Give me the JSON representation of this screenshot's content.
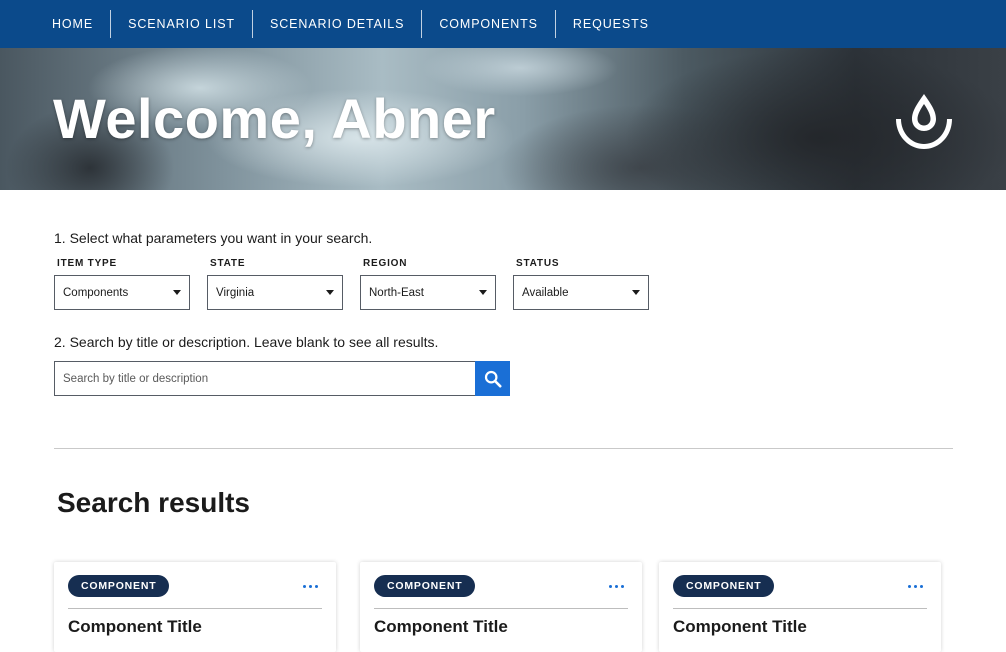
{
  "nav": {
    "items": [
      {
        "label": "HOME"
      },
      {
        "label": "SCENARIO LIST"
      },
      {
        "label": "SCENARIO DETAILS"
      },
      {
        "label": "COMPONENTS"
      },
      {
        "label": "REQUESTS"
      }
    ]
  },
  "hero": {
    "title": "Welcome, Abner",
    "logo_icon": "water-drop-icon"
  },
  "search": {
    "step1_label": "1. Select what parameters you want in your search.",
    "filters": [
      {
        "label": "ITEM TYPE",
        "value": "Components"
      },
      {
        "label": "STATE",
        "value": "Virginia"
      },
      {
        "label": "REGION",
        "value": "North-East"
      },
      {
        "label": "STATUS",
        "value": "Available"
      }
    ],
    "step2_label": "2. Search by title or description. Leave blank to see all results.",
    "placeholder": "Search by title or description",
    "button_icon": "search-icon"
  },
  "results": {
    "title": "Search results",
    "cards": [
      {
        "badge": "COMPONENT",
        "title": "Component Title"
      },
      {
        "badge": "COMPONENT",
        "title": "Component Title"
      },
      {
        "badge": "COMPONENT",
        "title": "Component Title"
      }
    ]
  },
  "colors": {
    "nav_bg": "#0b4a8b",
    "accent": "#1a6fd6",
    "badge_bg": "#162e51"
  }
}
